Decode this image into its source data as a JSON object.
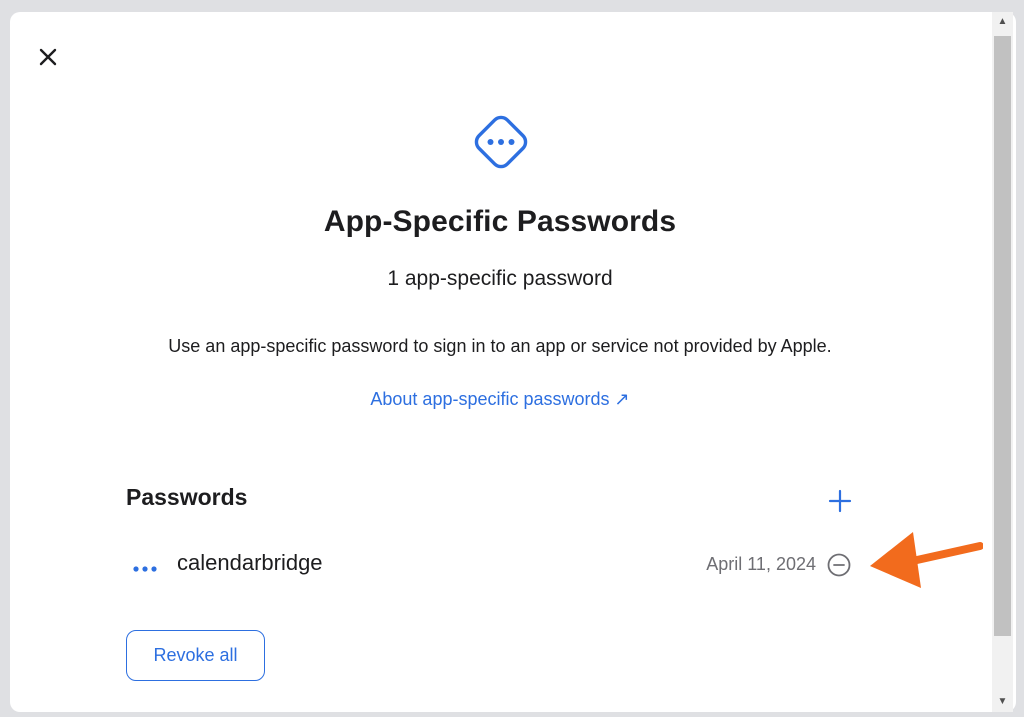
{
  "modal": {
    "title": "App-Specific Passwords",
    "subtitle": "1 app-specific password",
    "description": "Use an app-specific password to sign in to an app or service not provided by Apple.",
    "about_link": "About app-specific passwords ↗",
    "close_icon": "close-icon",
    "hero_icon": "ellipsis-diamond-icon"
  },
  "passwords": {
    "section_title": "Passwords",
    "add_icon": "plus-icon",
    "items": [
      {
        "name": "calendarbridge",
        "date": "April 11, 2024",
        "menu_icon": "more-dots-icon",
        "remove_icon": "minus-circle-icon"
      }
    ],
    "revoke_all_label": "Revoke all"
  },
  "scrollbar": {
    "up_glyph": "▲",
    "down_glyph": "▼"
  },
  "colors": {
    "accent": "#2d6fe0",
    "annotation_arrow": "#f26b1d",
    "text": "#1d1d1f",
    "secondary_text": "#6e6e73"
  }
}
